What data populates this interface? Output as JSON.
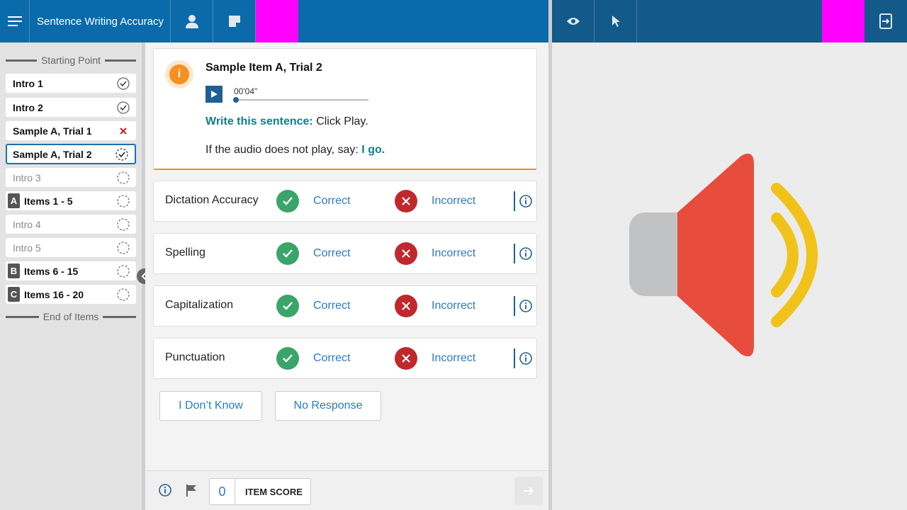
{
  "header": {
    "title": "Sentence Writing Accuracy"
  },
  "sidebar": {
    "start_label": "Starting Point",
    "end_label": "End of Items",
    "items": [
      {
        "label": "Intro 1",
        "status": "complete"
      },
      {
        "label": "Intro 2",
        "status": "complete"
      },
      {
        "label": "Sample A, Trial 1",
        "status": "incorrect"
      },
      {
        "label": "Sample A, Trial 2",
        "status": "in-progress"
      },
      {
        "label": "Intro 3",
        "status": "pending"
      },
      {
        "label": "Items 1 - 5",
        "badge": "A",
        "status": "pending"
      },
      {
        "label": "Intro 4",
        "status": "pending"
      },
      {
        "label": "Intro 5",
        "status": "pending"
      },
      {
        "label": "Items 6 - 15",
        "badge": "B",
        "status": "pending"
      },
      {
        "label": "Items 16 - 20",
        "badge": "C",
        "status": "pending"
      }
    ]
  },
  "card": {
    "title": "Sample Item A, Trial 2",
    "timer": "00'04\"",
    "instruction_label": "Write this sentence:",
    "instruction_text": " Click Play.",
    "fallback_text": "If the audio does not play, say: ",
    "fallback_phrase": "I go."
  },
  "scoring": {
    "correct_label": "Correct",
    "incorrect_label": "Incorrect",
    "rows": [
      {
        "label": "Dictation Accuracy"
      },
      {
        "label": "Spelling"
      },
      {
        "label": "Capitalization"
      },
      {
        "label": "Punctuation"
      }
    ]
  },
  "buttons": {
    "dont_know": "I Don’t Know",
    "no_response": "No Response"
  },
  "footer": {
    "score_value": "0",
    "score_label": "ITEM SCORE"
  },
  "colors": {
    "header_left": "#0b6aa9",
    "header_right": "#135a8a",
    "accent_teal": "#0f7f8f",
    "correct_green": "#3aa46a",
    "incorrect_red": "#c0282d",
    "warning_orange": "#f7901e",
    "highlight_magenta": "#ff00ff"
  }
}
